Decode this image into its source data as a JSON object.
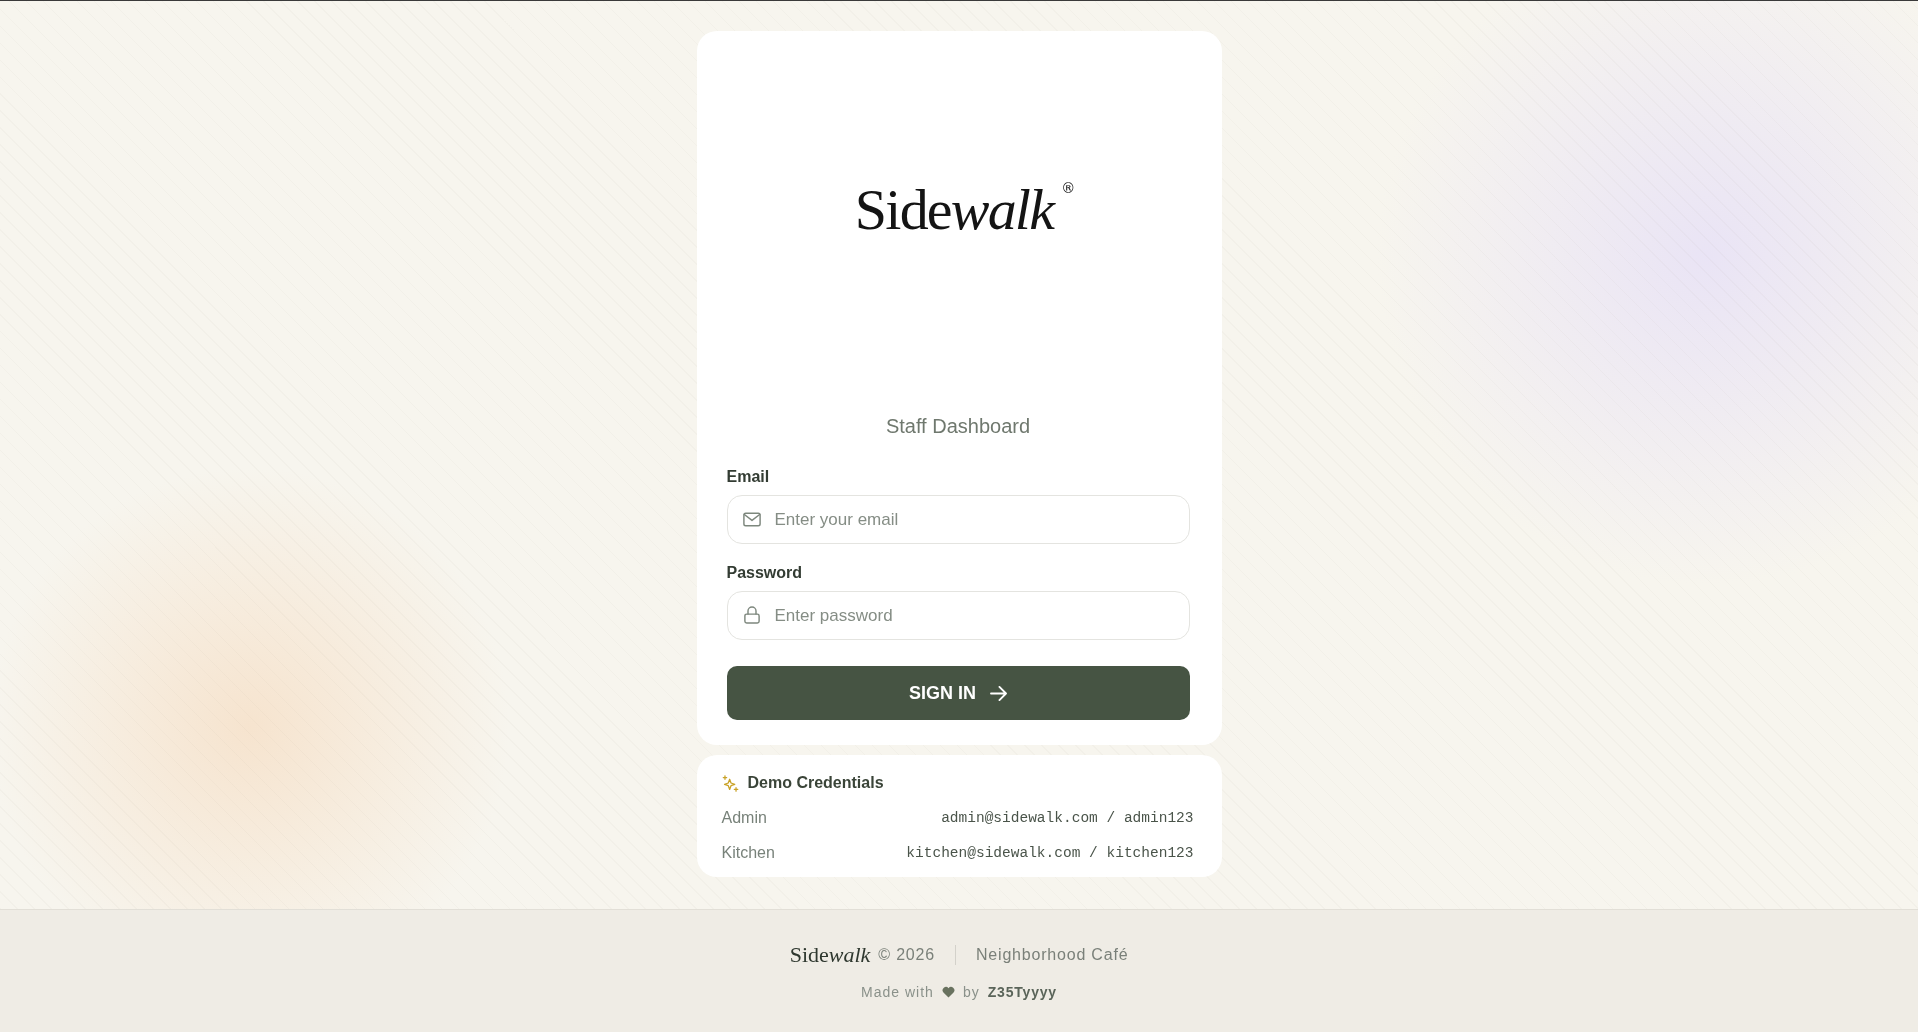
{
  "logo": {
    "parts": [
      {
        "text": "Side",
        "italic": false
      },
      {
        "text": "walk",
        "italic": true
      }
    ],
    "mark": "®"
  },
  "subtitle": "Staff Dashboard",
  "fields": [
    {
      "kind": "email",
      "label": "Email",
      "placeholder": "Enter your email"
    },
    {
      "kind": "password",
      "label": "Password",
      "placeholder": "Enter password"
    }
  ],
  "submit_button": {
    "label": "SIGN IN"
  },
  "demo_credentials": {
    "title": "Demo Credentials",
    "rows": [
      {
        "role": "Admin",
        "credentials": "admin@sidewalk.com / admin123"
      },
      {
        "role": "Kitchen",
        "credentials": "kitchen@sidewalk.com / kitchen123"
      }
    ]
  },
  "footer": {
    "brand": {
      "parts": [
        {
          "text": "Side",
          "italic": false
        },
        {
          "text": "walk",
          "italic": true
        }
      ]
    },
    "copyright": "© 2026",
    "tagline": "Neighborhood Café",
    "made_with": "Made with",
    "by": "by",
    "author": "Z35Tyyyy"
  }
}
